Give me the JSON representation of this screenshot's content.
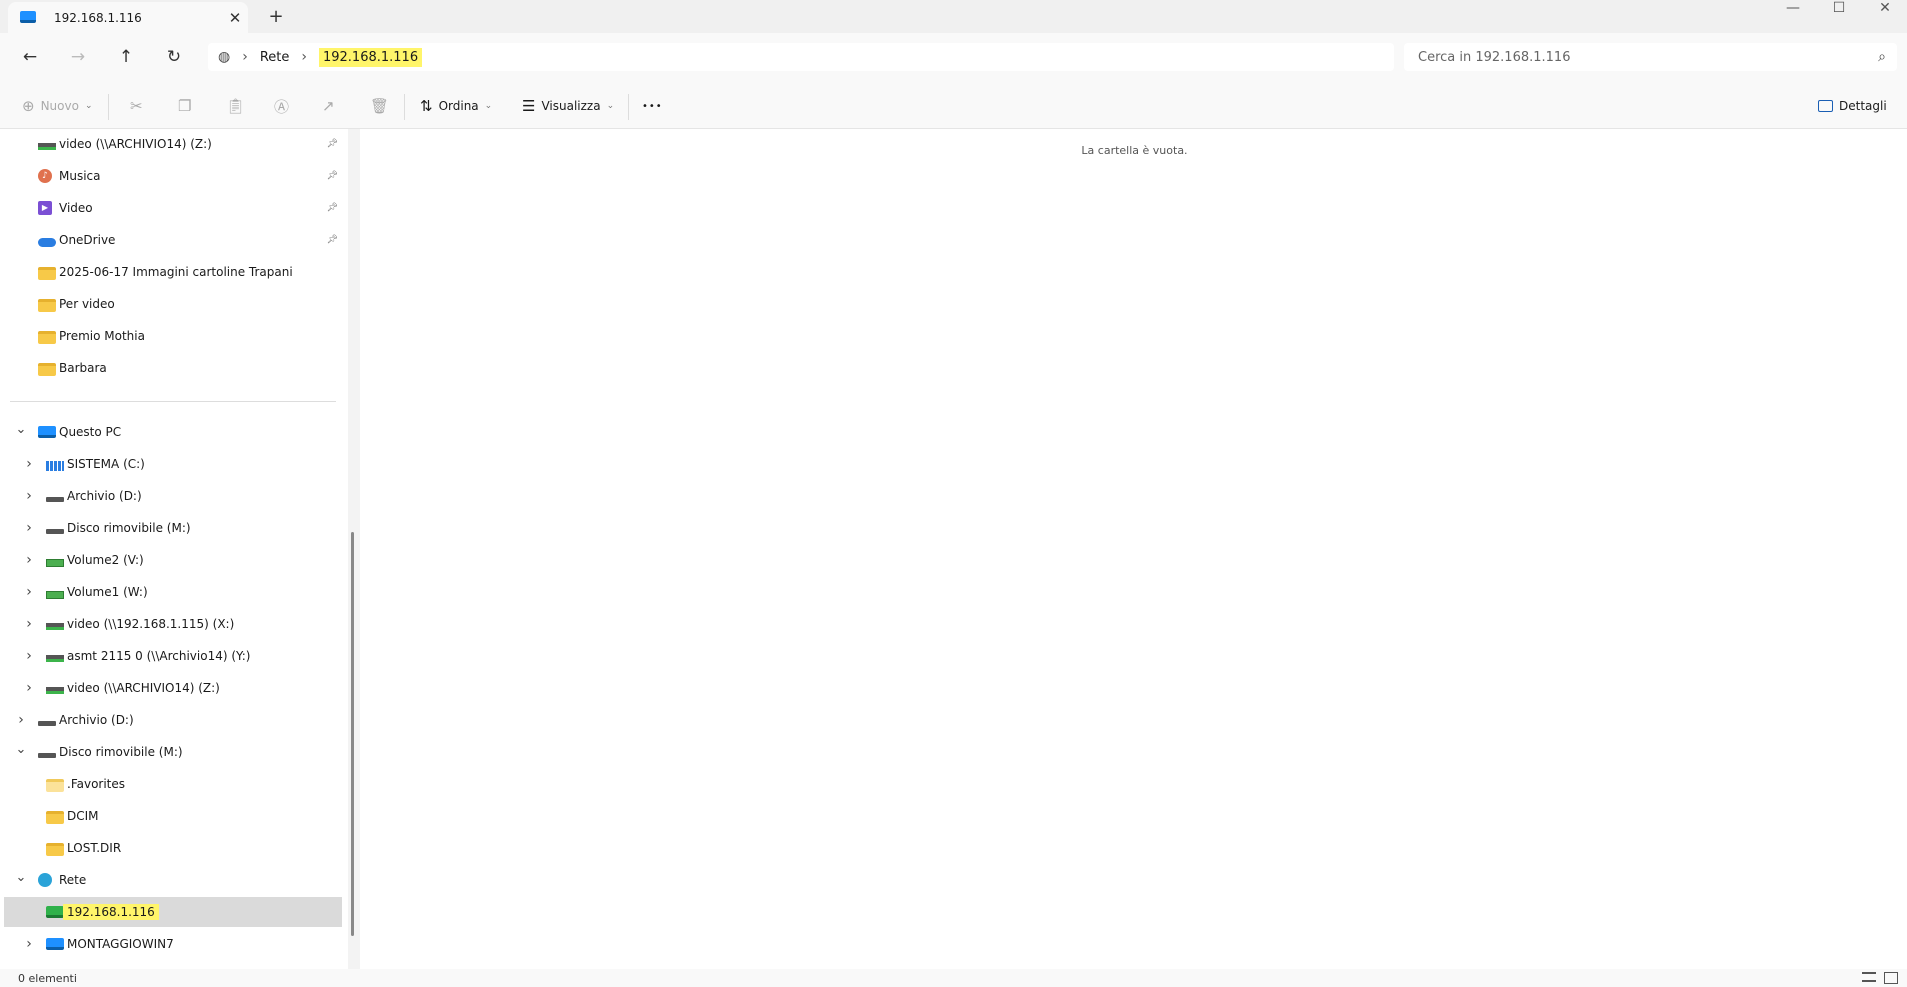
{
  "window": {
    "tab_title": "192.168.1.116",
    "tab_icon": "monitor-icon",
    "close_tab": "✕",
    "new_tab": "+",
    "minimize": "—",
    "maximize": "☐",
    "close": "✕"
  },
  "address": {
    "root_icon": "network-globe-icon",
    "crumbs": [
      "Rete",
      "192.168.1.116"
    ],
    "separator": "›"
  },
  "search": {
    "placeholder": "Cerca in 192.168.1.116"
  },
  "toolbar": {
    "new_label": "Nuovo",
    "sort_label": "Ordina",
    "view_label": "Visualizza",
    "more_label": "•••",
    "details_label": "Dettagli"
  },
  "sidebar": {
    "quick": [
      {
        "label": "video (\\\\ARCHIVIO14) (Z:)",
        "icon": "network-drive-icon",
        "pinned": true
      },
      {
        "label": "Musica",
        "icon": "music-icon",
        "pinned": true
      },
      {
        "label": "Video",
        "icon": "video-icon",
        "pinned": true
      },
      {
        "label": "OneDrive",
        "icon": "cloud-icon",
        "pinned": true
      },
      {
        "label": "2025-06-17 Immagini cartoline Trapani",
        "icon": "folder-icon",
        "pinned": false
      },
      {
        "label": "Per video",
        "icon": "folder-icon",
        "pinned": false
      },
      {
        "label": "Premio Mothia",
        "icon": "folder-icon",
        "pinned": false
      },
      {
        "label": "Barbara",
        "icon": "folder-icon",
        "pinned": false
      }
    ],
    "tree": [
      {
        "label": "Questo PC",
        "icon": "pc-icon",
        "level": 0,
        "expander": "expanded"
      },
      {
        "label": "SISTEMA (C:)",
        "icon": "system-drive-icon",
        "level": 1,
        "expander": "collapsed"
      },
      {
        "label": "Archivio (D:)",
        "icon": "drive-icon",
        "level": 1,
        "expander": "collapsed"
      },
      {
        "label": "Disco rimovibile (M:)",
        "icon": "drive-icon",
        "level": 1,
        "expander": "collapsed"
      },
      {
        "label": "Volume2 (V:)",
        "icon": "usb-drive-icon",
        "level": 1,
        "expander": "collapsed"
      },
      {
        "label": "Volume1 (W:)",
        "icon": "usb-drive-icon",
        "level": 1,
        "expander": "collapsed"
      },
      {
        "label": "video (\\\\192.168.1.115) (X:)",
        "icon": "network-drive-icon",
        "level": 1,
        "expander": "collapsed"
      },
      {
        "label": "asmt 2115 0 (\\\\Archivio14) (Y:)",
        "icon": "network-drive-icon",
        "level": 1,
        "expander": "collapsed"
      },
      {
        "label": "video (\\\\ARCHIVIO14) (Z:)",
        "icon": "network-drive-icon",
        "level": 1,
        "expander": "collapsed"
      },
      {
        "label": "Archivio (D:)",
        "icon": "drive-icon",
        "level": 0,
        "expander": "collapsed"
      },
      {
        "label": "Disco rimovibile (M:)",
        "icon": "drive-icon",
        "level": 0,
        "expander": "expanded"
      },
      {
        "label": ".Favorites",
        "icon": "folder-light-icon",
        "level": 1,
        "expander": "none"
      },
      {
        "label": "DCIM",
        "icon": "folder-icon",
        "level": 1,
        "expander": "none"
      },
      {
        "label": "LOST.DIR",
        "icon": "folder-icon",
        "level": 1,
        "expander": "none"
      },
      {
        "label": "Rete",
        "icon": "network-icon",
        "level": 0,
        "expander": "expanded"
      },
      {
        "label": "192.168.1.116",
        "icon": "computer-green-icon",
        "level": 1,
        "expander": "none",
        "selected": true,
        "highlight": true
      },
      {
        "label": "MONTAGGIOWIN7",
        "icon": "pc-icon",
        "level": 1,
        "expander": "collapsed"
      }
    ]
  },
  "content": {
    "empty_message": "La cartella è vuota."
  },
  "status": {
    "items": "0 elementi"
  },
  "colors": {
    "highlight": "#fff56a",
    "selection": "#dadada",
    "chrome": "#f9f9f9"
  }
}
